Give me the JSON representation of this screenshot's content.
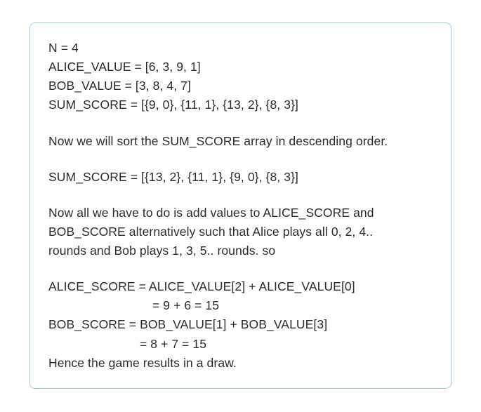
{
  "lines": {
    "n": "N = 4",
    "alice_value": "ALICE_VALUE = [6, 3, 9, 1]",
    "bob_value": "BOB_VALUE = [3, 8, 4, 7]",
    "sum_score_initial": "SUM_SCORE = [{9, 0}, {11, 1}, {13, 2}, {8, 3}]",
    "sort_text": "Now we will sort the SUM_SCORE array in descending order.",
    "sum_score_sorted": "SUM_SCORE = [{13, 2}, {11, 1}, {9, 0}, {8, 3}]",
    "explain1": "Now all we have to do is add values to ALICE_SCORE and",
    "explain2": "BOB_SCORE alternatively such that Alice plays all 0, 2, 4..",
    "explain3": "rounds and Bob plays 1, 3, 5.. rounds. so",
    "alice_score1": "ALICE_SCORE = ALICE_VALUE[2] + ALICE_VALUE[0]",
    "alice_score2": "= 9 + 6 = 15",
    "bob_score1": "BOB_SCORE = BOB_VALUE[1] + BOB_VALUE[3]",
    "bob_score2": "= 8 + 7 = 15",
    "conclusion": "Hence the game results in a draw."
  }
}
